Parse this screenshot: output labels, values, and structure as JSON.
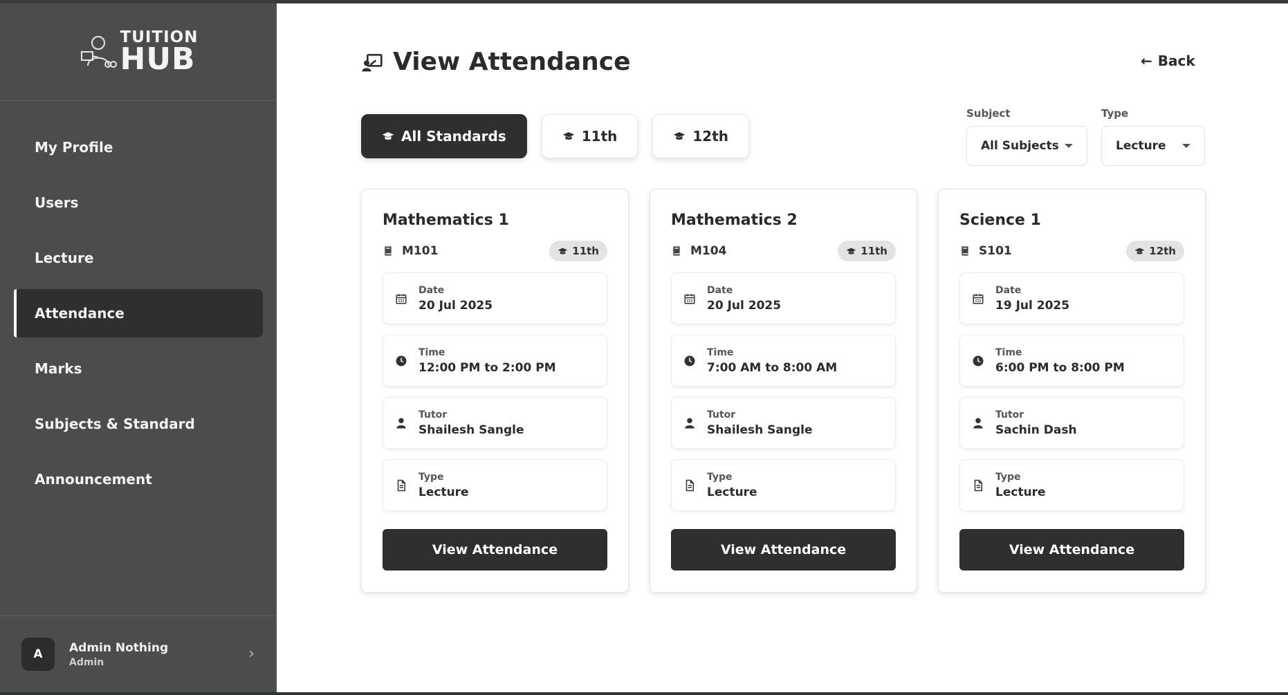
{
  "brand": {
    "line1": "TUITION",
    "line2": "HUB"
  },
  "sidebar": {
    "items": [
      {
        "label": "My Profile",
        "active": false
      },
      {
        "label": "Users",
        "active": false
      },
      {
        "label": "Lecture",
        "active": false
      },
      {
        "label": "Attendance",
        "active": true
      },
      {
        "label": "Marks",
        "active": false
      },
      {
        "label": "Subjects & Standard",
        "active": false
      },
      {
        "label": "Announcement",
        "active": false
      }
    ],
    "user": {
      "initial": "A",
      "name": "Admin Nothing",
      "role": "Admin"
    }
  },
  "header": {
    "title": "View Attendance",
    "back_label": "Back"
  },
  "filters": {
    "standards": [
      {
        "label": "All Standards",
        "active": true
      },
      {
        "label": "11th",
        "active": false
      },
      {
        "label": "12th",
        "active": false
      }
    ],
    "subject": {
      "label": "Subject",
      "value": "All Subjects"
    },
    "type": {
      "label": "Type",
      "value": "Lecture"
    }
  },
  "labels": {
    "date": "Date",
    "time": "Time",
    "tutor": "Tutor",
    "type": "Type",
    "view_button": "View Attendance"
  },
  "cards": [
    {
      "title": "Mathematics 1",
      "code": "M101",
      "standard": "11th",
      "date": "20 Jul 2025",
      "time": "12:00 PM to 2:00 PM",
      "tutor": "Shailesh Sangle",
      "type": "Lecture"
    },
    {
      "title": "Mathematics 2",
      "code": "M104",
      "standard": "11th",
      "date": "20 Jul 2025",
      "time": "7:00 AM to 8:00 AM",
      "tutor": "Shailesh Sangle",
      "type": "Lecture"
    },
    {
      "title": "Science 1",
      "code": "S101",
      "standard": "12th",
      "date": "19 Jul 2025",
      "time": "6:00 PM to 8:00 PM",
      "tutor": "Sachin Dash",
      "type": "Lecture"
    }
  ],
  "colors": {
    "sidebar_bg": "#4c4c4c",
    "active_bg": "#2f2f2f",
    "main_bg": "#ffffff"
  }
}
